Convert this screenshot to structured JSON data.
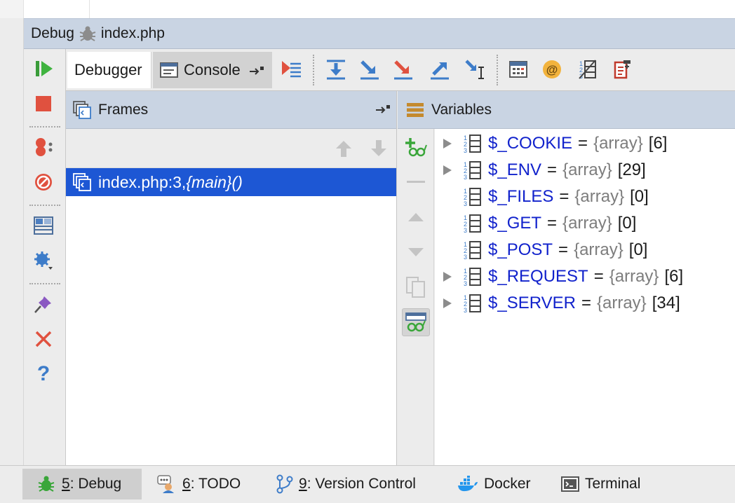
{
  "title_bar": {
    "label": "Debug",
    "file": "index.php"
  },
  "tabs": {
    "debugger": "Debugger",
    "console": "Console"
  },
  "frames": {
    "header": "Frames",
    "rows": [
      {
        "location": "index.php:3, ",
        "function": "{main}()"
      }
    ]
  },
  "variables": {
    "header": "Variables",
    "items": [
      {
        "name": "$_COOKIE",
        "eq": "=",
        "type": "{array}",
        "count": "[6]",
        "expandable": true
      },
      {
        "name": "$_ENV",
        "eq": "=",
        "type": "{array}",
        "count": "[29]",
        "expandable": true
      },
      {
        "name": "$_FILES",
        "eq": "=",
        "type": "{array}",
        "count": "[0]",
        "expandable": false
      },
      {
        "name": "$_GET",
        "eq": "=",
        "type": "{array}",
        "count": "[0]",
        "expandable": false
      },
      {
        "name": "$_POST",
        "eq": "=",
        "type": "{array}",
        "count": "[0]",
        "expandable": false
      },
      {
        "name": "$_REQUEST",
        "eq": "=",
        "type": "{array}",
        "count": "[6]",
        "expandable": true
      },
      {
        "name": "$_SERVER",
        "eq": "=",
        "type": "{array}",
        "count": "[34]",
        "expandable": true
      }
    ]
  },
  "bottom_bar": [
    {
      "mnemonic": "5",
      "label": ": Debug",
      "icon": "bug-icon",
      "active": true
    },
    {
      "mnemonic": "6",
      "label": ": TODO",
      "icon": "todo-icon",
      "active": false
    },
    {
      "mnemonic": "9",
      "label": ": Version Control",
      "icon": "vcs-icon",
      "active": false
    },
    {
      "mnemonic": "",
      "label": "Docker",
      "icon": "docker-icon",
      "active": false
    },
    {
      "mnemonic": "",
      "label": "Terminal",
      "icon": "terminal-icon",
      "active": false
    }
  ],
  "colors": {
    "header_bg": "#c9d4e3",
    "selection": "#1d57d4",
    "var_name": "#1122cc",
    "var_type": "#7d7d7d"
  }
}
